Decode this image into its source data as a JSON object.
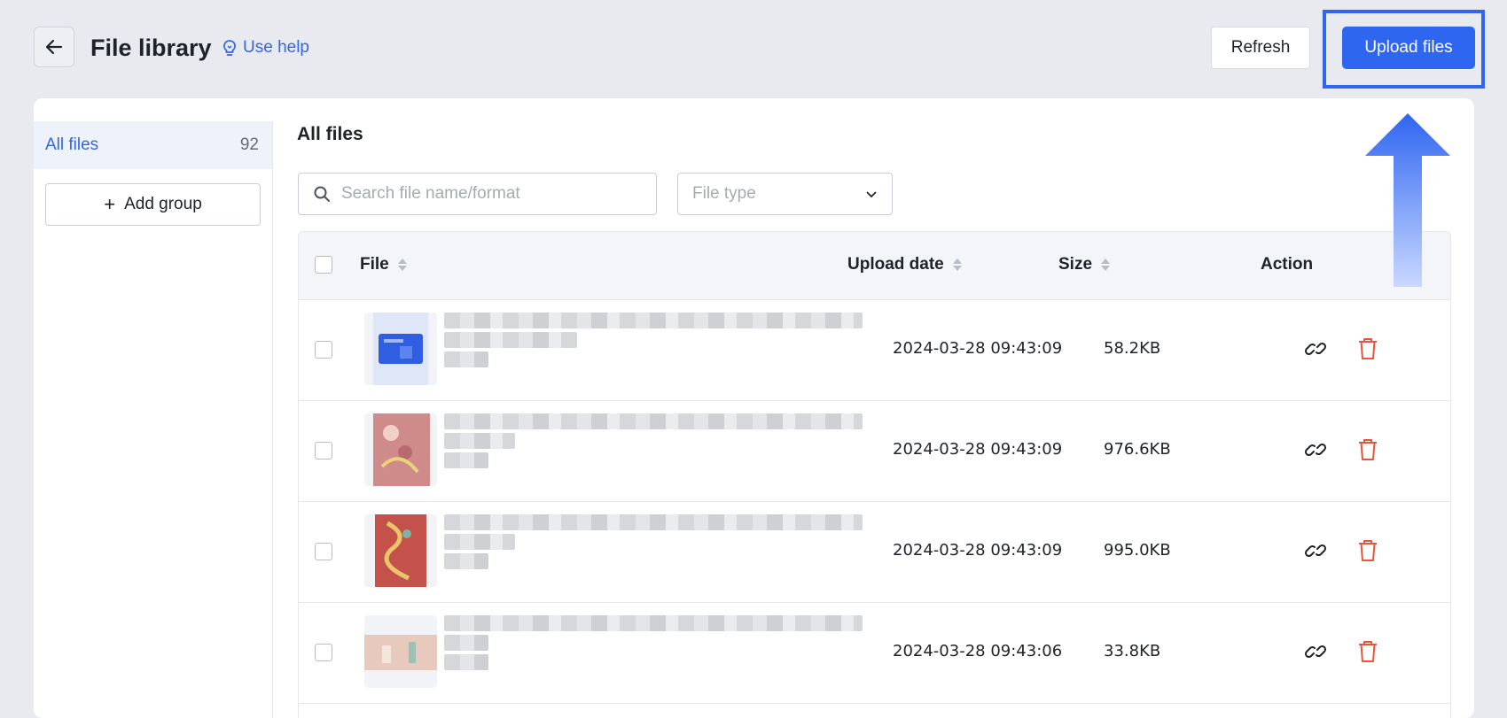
{
  "header": {
    "title": "File library",
    "help_label": "Use help",
    "refresh_label": "Refresh",
    "upload_label": "Upload files"
  },
  "sidebar": {
    "groups": [
      {
        "label": "All files",
        "count": "92"
      }
    ],
    "add_group_label": "Add group"
  },
  "main": {
    "section_title": "All files",
    "search": {
      "placeholder": "Search file name/format"
    },
    "file_type": {
      "placeholder": "File type"
    },
    "table": {
      "columns": {
        "file": "File",
        "upload_date": "Upload date",
        "size": "Size",
        "action": "Action"
      },
      "rows": [
        {
          "upload_date": "2024-03-28 09:43:09",
          "size": "58.2KB",
          "thumb": "gift-card"
        },
        {
          "upload_date": "2024-03-28 09:43:09",
          "size": "976.6KB",
          "thumb": "pink-beads"
        },
        {
          "upload_date": "2024-03-28 09:43:09",
          "size": "995.0KB",
          "thumb": "red-beads"
        },
        {
          "upload_date": "2024-03-28 09:43:06",
          "size": "33.8KB",
          "thumb": "banner"
        }
      ]
    }
  },
  "colors": {
    "accent": "#2f66f0",
    "link": "#3366e0",
    "delete": "#e8553a",
    "background": "#e8eaef"
  },
  "icons": {
    "back": "arrow-left-icon",
    "help": "lightbulb-icon",
    "search": "search-icon",
    "dropdown": "chevron-down-icon",
    "row_link": "link-icon",
    "row_delete": "trash-icon",
    "annotation": "up-arrow-icon"
  }
}
